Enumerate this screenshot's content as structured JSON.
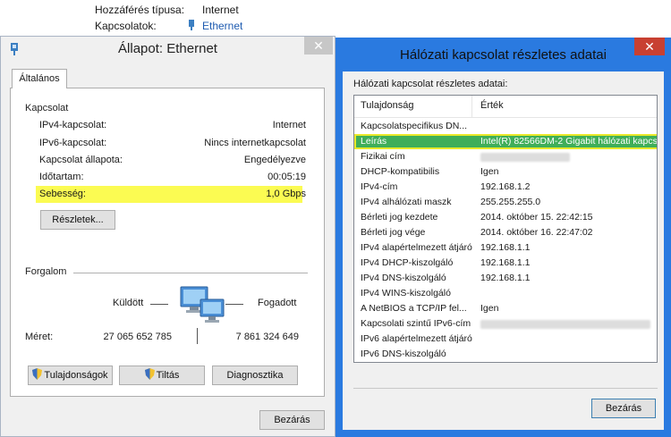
{
  "background": {
    "access_type_label": "Hozzáférés típusa:",
    "access_type_value": "Internet",
    "connections_label": "Kapcsolatok:",
    "connections_value": "Ethernet"
  },
  "status_window": {
    "title": "Állapot: Ethernet",
    "close_glyph": "✕",
    "tab_label": "Általános",
    "connection_section": "Kapcsolat",
    "rows": [
      {
        "label": "IPv4-kapcsolat:",
        "value": "Internet"
      },
      {
        "label": "IPv6-kapcsolat:",
        "value": "Nincs internetkapcsolat"
      },
      {
        "label": "Kapcsolat állapota:",
        "value": "Engedélyezve"
      },
      {
        "label": "Időtartam:",
        "value": "00:05:19"
      },
      {
        "label": "Sebesség:",
        "value": "1,0 Gbps"
      }
    ],
    "details_button": "Részletek...",
    "traffic_section": "Forgalom",
    "sent_label": "Küldött",
    "received_label": "Fogadott",
    "size_label": "Méret:",
    "sent_value": "27 065 652 785",
    "received_value": "7 861 324 649",
    "properties_button": "Tulajdonságok",
    "disable_button": "Tiltás",
    "diagnose_button": "Diagnosztika",
    "close_button": "Bezárás",
    "highlight_color": "#fbfb52"
  },
  "details_window": {
    "title": "Hálózati kapcsolat részletes adatai",
    "close_glyph": "✕",
    "caption": "Hálózati kapcsolat részletes adatai:",
    "col_property": "Tulajdonság",
    "col_value": "Érték",
    "rows": [
      {
        "prop": "Kapcsolatspecifikus DN...",
        "val": ""
      },
      {
        "prop": "Leírás",
        "val": "Intel(R) 82566DM-2 Gigabit hálózati kapcs"
      },
      {
        "prop": "Fizikai cím",
        "val": ""
      },
      {
        "prop": "DHCP-kompatibilis",
        "val": "Igen"
      },
      {
        "prop": "IPv4-cím",
        "val": "192.168.1.2"
      },
      {
        "prop": "IPv4 alhálózati maszk",
        "val": "255.255.255.0"
      },
      {
        "prop": "Bérleti jog kezdete",
        "val": "2014. október 15. 22:42:15"
      },
      {
        "prop": "Bérleti jog vége",
        "val": "2014. október 16. 22:47:02"
      },
      {
        "prop": "IPv4 alapértelmezett átjáró",
        "val": "192.168.1.1"
      },
      {
        "prop": "IPv4 DHCP-kiszolgáló",
        "val": "192.168.1.1"
      },
      {
        "prop": "IPv4 DNS-kiszolgáló",
        "val": "192.168.1.1"
      },
      {
        "prop": "IPv4 WINS-kiszolgáló",
        "val": ""
      },
      {
        "prop": "A NetBIOS a TCP/IP fel...",
        "val": "Igen"
      },
      {
        "prop": "Kapcsolati szintű IPv6-cím",
        "val": ""
      },
      {
        "prop": "IPv6 alapértelmezett átjáró",
        "val": ""
      },
      {
        "prop": "IPv6 DNS-kiszolgáló",
        "val": ""
      }
    ],
    "close_button": "Bezárás",
    "accent_color": "#2a7ae0",
    "selected_row_color": "#3fae59"
  }
}
